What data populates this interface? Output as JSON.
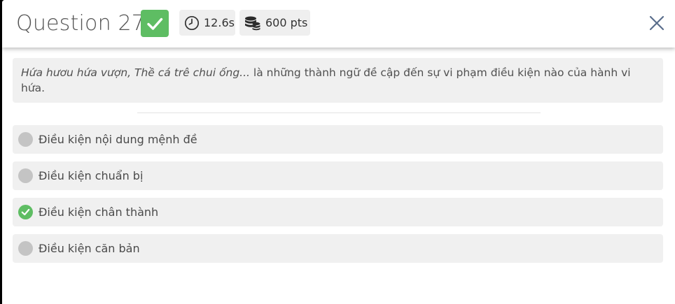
{
  "header": {
    "title": "Question 27",
    "time": "12.6s",
    "points": "600 pts"
  },
  "question": {
    "italic_part": "Hứa hươu hứa vượn, Thề cá trê chui ống...",
    "rest": " là những thành ngữ đề cập đến sự vi phạm điều kiện nào của hành vi hứa."
  },
  "options": [
    {
      "label": "Điều kiện nội dung mệnh đề",
      "state": "unselected"
    },
    {
      "label": "Điều kiện chuẩn bị",
      "state": "unselected"
    },
    {
      "label": "Điều kiện chân thành",
      "state": "correct"
    },
    {
      "label": "Điều kiện căn bản",
      "state": "unselected"
    }
  ],
  "icons": {
    "correct_badge": "check-icon",
    "time": "clock-icon",
    "points": "coins-icon",
    "close": "close-icon"
  },
  "colors": {
    "correct": "#5ebd63",
    "unselected": "#c4c4c4",
    "option_bg": "#f0f0f0"
  }
}
